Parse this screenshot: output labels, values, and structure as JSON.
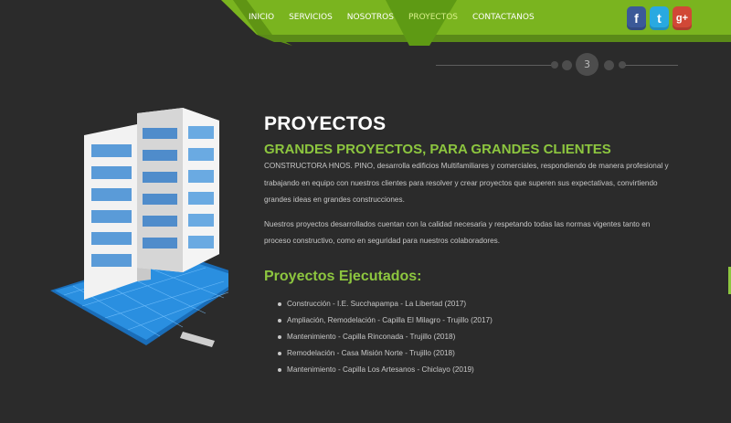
{
  "nav": {
    "items": [
      {
        "label": "INICIO",
        "active": false
      },
      {
        "label": "SERVICIOS",
        "active": false
      },
      {
        "label": "NOSOTROS",
        "active": false
      },
      {
        "label": "PROYECTOS",
        "active": true
      },
      {
        "label": "CONTACTANOS",
        "active": false
      }
    ]
  },
  "social": {
    "facebook": {
      "glyph": "f",
      "icon": "facebook-icon",
      "color": "#3b5998"
    },
    "twitter": {
      "glyph": "t",
      "icon": "twitter-icon",
      "color": "#29a9e1"
    },
    "googleplus": {
      "glyph": "g+",
      "icon": "google-plus-icon",
      "color": "#d14836"
    }
  },
  "slider": {
    "current_page": "3"
  },
  "main": {
    "title": "PROYECTOS",
    "subtitle": "GRANDES PROYECTOS, PARA GRANDES CLIENTES",
    "paragraph1": "CONSTRUCTORA HNOS. PINO, desarrolla edificios Multifamiliares y comerciales, respondiendo de manera profesional y trabajando en equipo con nuestros clientes para resolver y crear proyectos que superen sus expectativas, convirtiendo grandes ideas en grandes construcciones.",
    "paragraph2": "Nuestros proyectos desarrollados cuentan con la calidad necesaria y respetando todas las normas vigentes tanto en proceso constructivo, como en seguridad para nuestros colaboradores.",
    "projects_title": "Proyectos Ejecutados:",
    "projects": [
      "Construcción - I.E. Succhapampa - La Libertad (2017)",
      "Ampliación, Remodelación - Capilla El Milagro - Trujillo (2017)",
      "Mantenimiento - Capilla Rinconada - Trujillo (2018)",
      "Remodelación - Casa Misión Norte - Trujillo (2018)",
      "Mantenimiento - Capilla Los Artesanos - Chiclayo (2019)"
    ]
  },
  "colors": {
    "accent_green": "#8dc63f",
    "nav_green": "#7ab41f",
    "background": "#2b2b2b"
  },
  "illustration": {
    "icon": "building-blueprint-icon"
  }
}
